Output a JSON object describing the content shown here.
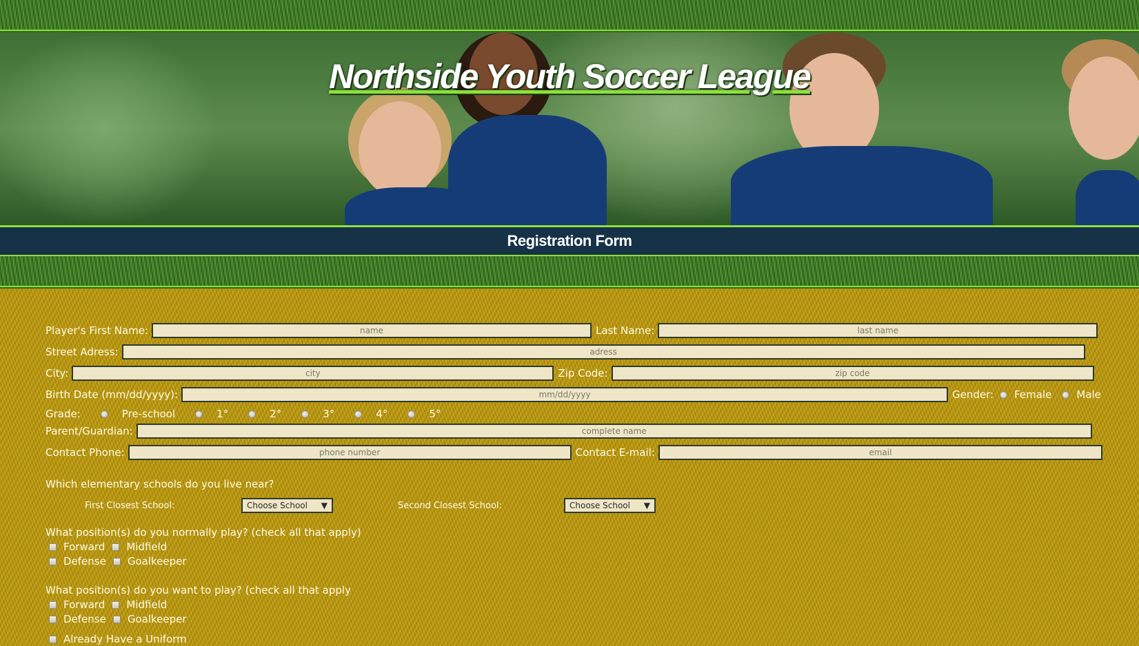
{
  "site": {
    "title": "Northside Youth Soccer League",
    "form_heading": "Registration Form"
  },
  "fields": {
    "first_name": {
      "label": "Player's First Name:",
      "placeholder": "name"
    },
    "last_name": {
      "label": "Last Name:",
      "placeholder": "last name"
    },
    "street": {
      "label": "Street Adress:",
      "placeholder": "adress"
    },
    "city": {
      "label": "City:",
      "placeholder": "city"
    },
    "zip": {
      "label": "Zip Code:",
      "placeholder": "zip code"
    },
    "birth": {
      "label": "Birth Date (mm/dd/yyyy):",
      "placeholder": "mm/dd/yyyy"
    },
    "guardian": {
      "label": "Parent/Guardian:",
      "placeholder": "complete name"
    },
    "phone": {
      "label": "Contact Phone:",
      "placeholder": "phone number"
    },
    "email": {
      "label": "Contact E-mail:",
      "placeholder": "email"
    }
  },
  "gender": {
    "label": "Gender:",
    "options": [
      "Female",
      "Male"
    ]
  },
  "grade": {
    "label": "Grade:",
    "options": [
      "Pre-school",
      "1°",
      "2°",
      "3°",
      "4°",
      "5°"
    ]
  },
  "schools": {
    "question": "Which elementary schools do you live near?",
    "first_label": "First Closest School:",
    "second_label": "Second Closest School:",
    "select_value": "Choose School",
    "arrow": "▼"
  },
  "positions_normal": {
    "question": "What position(s) do you normally play? (check all that apply)",
    "options": [
      "Forward",
      "Midfield",
      "Defense",
      "Goalkeeper"
    ]
  },
  "positions_want": {
    "question": "What position(s) do you want to play? (check all that apply",
    "options": [
      "Forward",
      "Midfield",
      "Defense",
      "Goalkeeper"
    ]
  },
  "uniform": {
    "label": "Already Have a Uniform"
  }
}
